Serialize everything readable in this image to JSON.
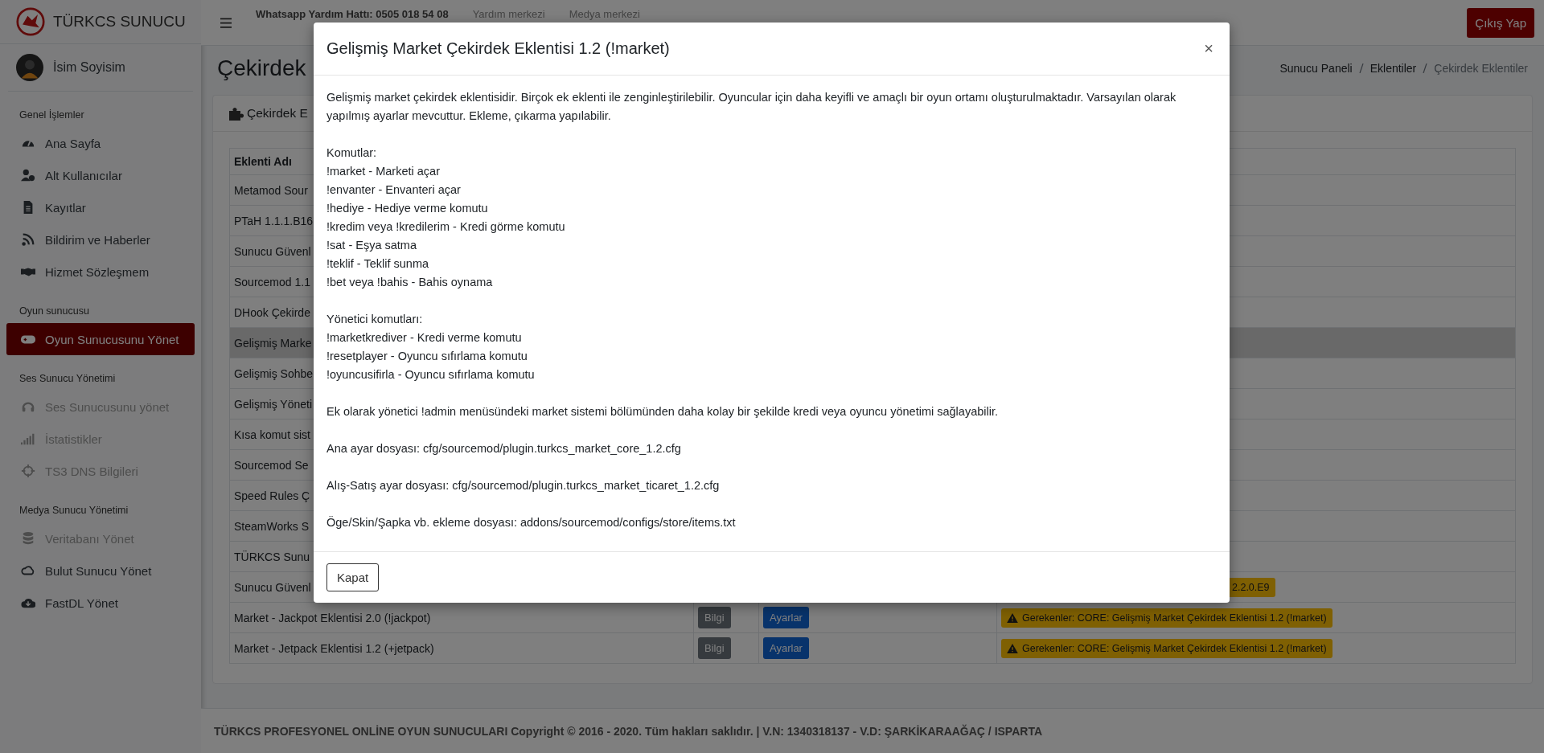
{
  "brand": {
    "name": "TÜRKCS SUNUCU"
  },
  "user": {
    "name": "İsim Soyisim"
  },
  "sidebar": {
    "sections": [
      {
        "heading": "Genel İşlemler",
        "items": [
          {
            "label": "Ana Sayfa",
            "selected": false,
            "disabled": false
          },
          {
            "label": "Alt Kullanıcılar",
            "selected": false,
            "disabled": false
          },
          {
            "label": "Kayıtlar",
            "selected": false,
            "disabled": false
          },
          {
            "label": "Bildirim ve Haberler",
            "selected": false,
            "disabled": false
          },
          {
            "label": "Hizmet Sözleşmem",
            "selected": false,
            "disabled": false
          }
        ]
      },
      {
        "heading": "Oyun sunucusu",
        "items": [
          {
            "label": "Oyun Sunucusunu Yönet",
            "selected": true,
            "disabled": false
          }
        ]
      },
      {
        "heading": "Ses Sunucu Yönetimi",
        "items": [
          {
            "label": "Ses Sunucusunu yönet",
            "selected": false,
            "disabled": true
          },
          {
            "label": "İstatistikler",
            "selected": false,
            "disabled": true
          },
          {
            "label": "TS3 DNS Bilgileri",
            "selected": false,
            "disabled": true
          }
        ]
      },
      {
        "heading": "Medya Sunucu Yönetimi",
        "items": [
          {
            "label": "Veritabanı Yönet",
            "selected": false,
            "disabled": true
          },
          {
            "label": "Bulut Sunucu Yönet",
            "selected": false,
            "disabled": false
          },
          {
            "label": "FastDL Yönet",
            "selected": false,
            "disabled": false
          }
        ]
      }
    ]
  },
  "topbar": {
    "links": [
      "Whatsapp Yardım Hattı: 0505 018 54 08",
      "Yardım merkezi",
      "Medya merkezi"
    ],
    "logout": "Çıkış Yap"
  },
  "page": {
    "title": "Çekirdek",
    "breadcrumb": [
      "Sunucu Paneli",
      "Eklentiler",
      "Çekirdek Eklentiler"
    ]
  },
  "card": {
    "title": "Çekirdek E"
  },
  "table": {
    "columns": [
      "Eklenti Adı"
    ],
    "rows": [
      {
        "name": "Metamod Sour",
        "selected": false
      },
      {
        "name": "PTaH 1.1.1.B16",
        "selected": false
      },
      {
        "name": "Sunucu Güvenl",
        "selected": false
      },
      {
        "name": "Sourcemod 1.1",
        "selected": false
      },
      {
        "name": "DHook Çekirde",
        "selected": false
      },
      {
        "name": "Gelişmiş Marke",
        "selected": true
      },
      {
        "name": "Gelişmiş Sohbe",
        "selected": false
      },
      {
        "name": "Gelişmiş Yöneti",
        "selected": false
      },
      {
        "name": "Kısa komut sist",
        "selected": false
      },
      {
        "name": "Sourcemod Se",
        "selected": false
      },
      {
        "name": "Speed Rules Ç",
        "selected": false
      },
      {
        "name": "SteamWorks S",
        "selected": false
      },
      {
        "name": "TÜRKCS Sunu",
        "selected": false
      },
      {
        "name": "Sunucu Güvenl",
        "selected": false,
        "requirement_tail": "2.2.0.E9"
      },
      {
        "name": "Market - Jackpot Eklentisi 2.0 (!jackpot)",
        "selected": false,
        "info": "Bilgi",
        "settings": "Ayarlar",
        "requirement": "Gerekenler: CORE: Gelişmiş Market Çekirdek Eklentisi 1.2 (!market)"
      },
      {
        "name": "Market - Jetpack Eklentisi 1.2 (+jetpack)",
        "selected": false,
        "info": "Bilgi",
        "settings": "Ayarlar",
        "requirement": "Gerekenler: CORE: Gelişmiş Market Çekirdek Eklentisi 1.2 (!market)"
      }
    ]
  },
  "footer": "TÜRKCS PROFESYONEL ONLİNE OYUN SUNUCULARI Copyright © 2016 - 2020. Tüm hakları saklıdır. | V.N: 1340318137 - V.D: ŞARKİKARAAĞAÇ / ISPARTA",
  "modal": {
    "title": "Gelişmiş Market Çekirdek Eklentisi 1.2 (!market)",
    "close": "×",
    "paragraphs": [
      [
        "Gelişmiş market çekirdek eklentisidir. Birçok ek eklenti ile zenginleştirilebilir. Oyuncular için daha keyifli ve amaçlı bir oyun ortamı oluşturulmaktadır. Varsayılan olarak yapılmış ayarlar mevcuttur. Ekleme, çıkarma yapılabilir."
      ],
      [
        "Komutlar:",
        "!market - Marketi açar",
        "!envanter - Envanteri açar",
        "!hediye - Hediye verme komutu",
        "!kredim veya !kredilerim - Kredi görme komutu",
        "!sat - Eşya satma",
        "!teklif - Teklif sunma",
        "!bet veya !bahis - Bahis oynama"
      ],
      [
        "Yönetici komutları:",
        "!marketkrediver - Kredi verme komutu",
        "!resetplayer - Oyuncu sıfırlama komutu",
        "!oyuncusifirla - Oyuncu sıfırlama komutu"
      ],
      [
        "Ek olarak yönetici !admin menüsündeki market sistemi bölümünden daha kolay bir şekilde kredi veya oyuncu yönetimi sağlayabilir."
      ],
      [
        "Ana ayar dosyası: cfg/sourcemod/plugin.turkcs_market_core_1.2.cfg"
      ],
      [
        "Alış-Satış ayar dosyası: cfg/sourcemod/plugin.turkcs_market_ticaret_1.2.cfg"
      ],
      [
        "Öge/Skin/Şapka vb. ekleme dosyası: addons/sourcemod/configs/store/items.txt"
      ]
    ],
    "button": "Kapat"
  }
}
